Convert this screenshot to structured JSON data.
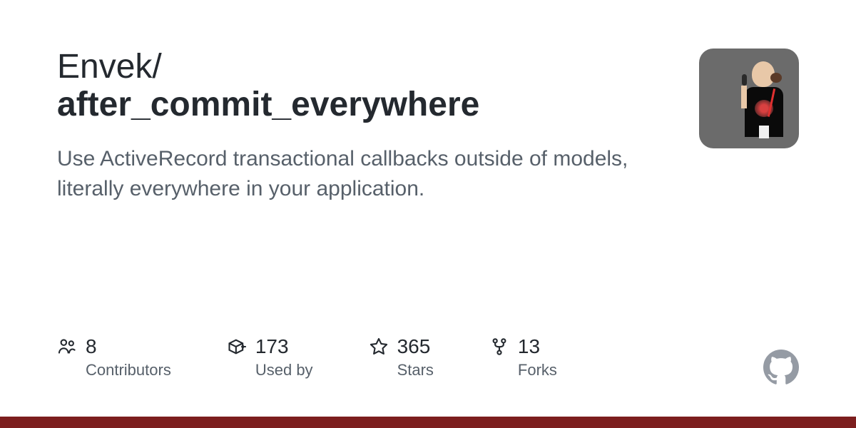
{
  "owner": "Envek",
  "separator": "/",
  "repo": "after_commit_everywhere",
  "description": "Use ActiveRecord transactional callbacks outside of models, literally everywhere in your application.",
  "stats": {
    "contributors": {
      "value": "8",
      "label": "Contributors"
    },
    "usedby": {
      "value": "173",
      "label": "Used by"
    },
    "stars": {
      "value": "365",
      "label": "Stars"
    },
    "forks": {
      "value": "13",
      "label": "Forks"
    }
  },
  "accent_color": "#7c1e1e"
}
